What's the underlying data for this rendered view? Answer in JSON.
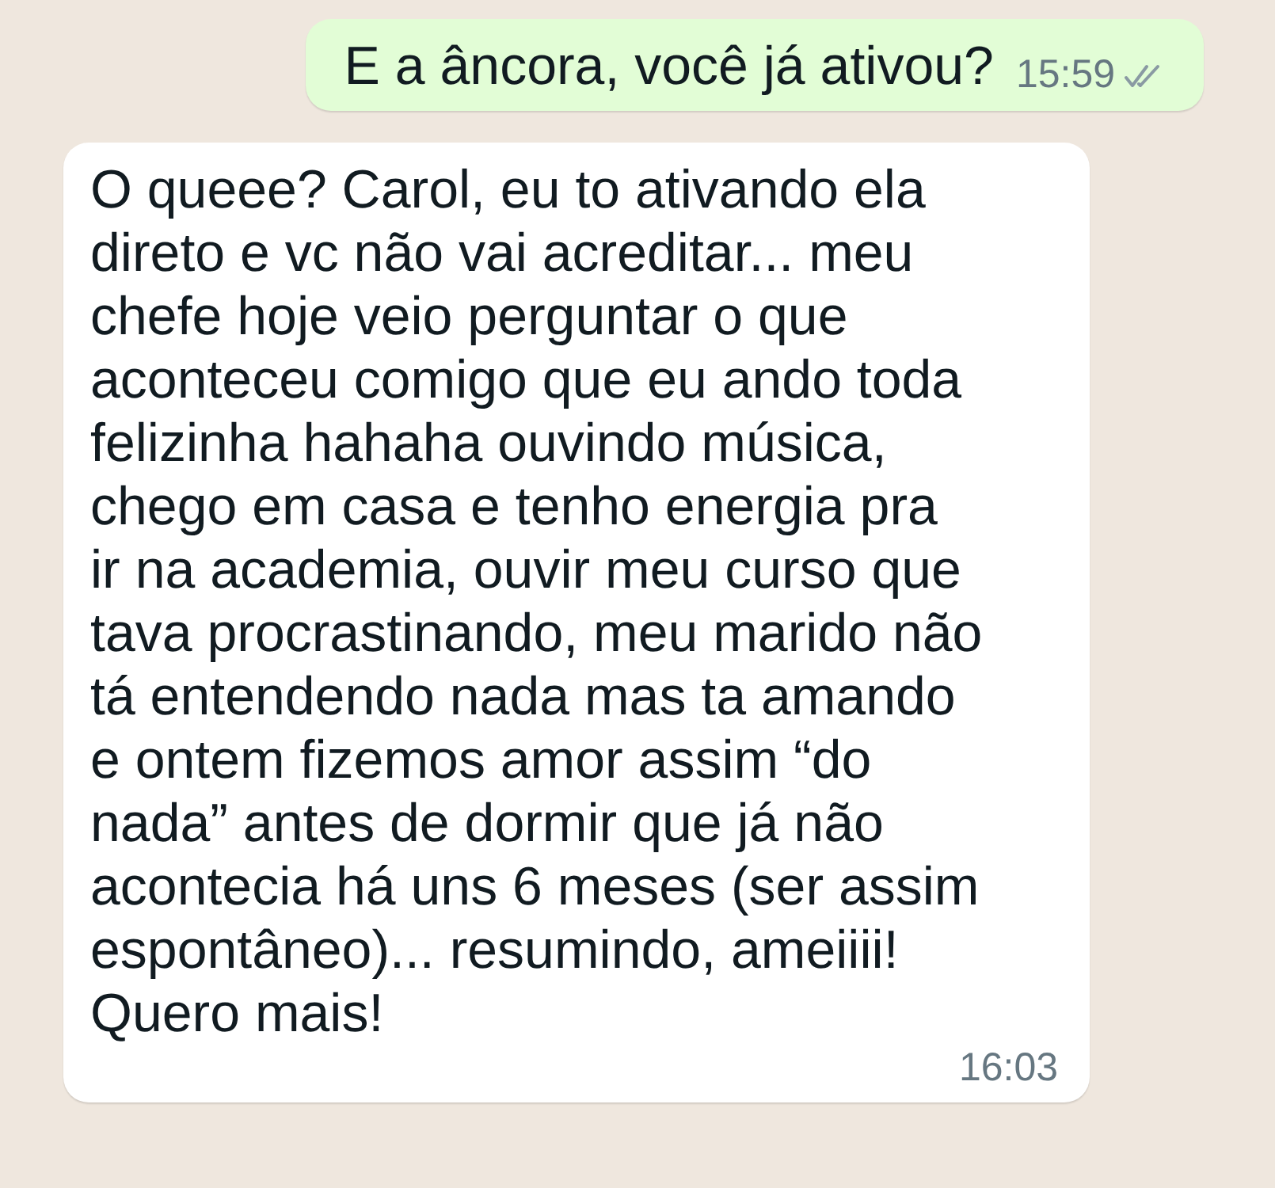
{
  "messages": [
    {
      "kind": "outgoing",
      "text": "E a âncora, você já ativou?",
      "time": "15:59",
      "read": false
    },
    {
      "kind": "incoming",
      "text": "O queee? Carol, eu to ativando ela\ndireto e vc não vai acreditar... meu\nchefe hoje veio perguntar o que\naconteceu comigo que eu ando toda\nfelizinha hahaha ouvindo música,\nchego em casa e tenho energia pra\nir na academia, ouvir meu curso que\ntava procrastinando, meu marido não\ntá entendendo nada mas ta amando\ne ontem fizemos amor assim “do\nnada” antes de dormir que já não\nacontecia há uns 6 meses (ser assim\nespontâneo)... resumindo, ameiiii!\nQuero mais!",
      "time": "16:03"
    }
  ]
}
